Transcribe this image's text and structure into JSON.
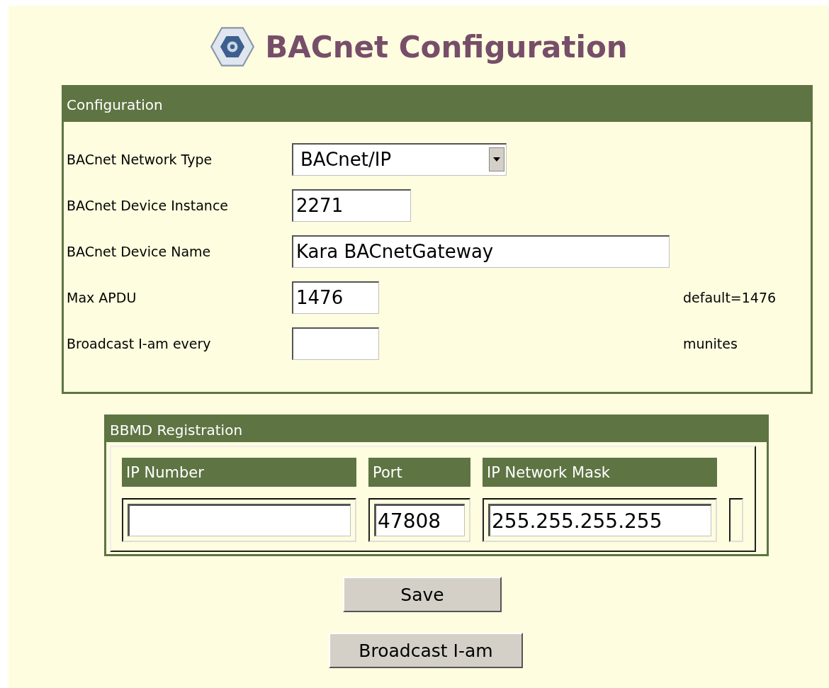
{
  "title": "BACnet Configuration",
  "configuration": {
    "heading": "Configuration",
    "fields": [
      {
        "kind": "select",
        "label": "BACnet Network Type",
        "value": "BACnet/IP"
      },
      {
        "kind": "text",
        "label": "BACnet Device Instance",
        "value": "2271"
      },
      {
        "kind": "text",
        "label": "BACnet Device Name",
        "value": "Kara BACnetGateway"
      },
      {
        "kind": "text",
        "label": "Max APDU",
        "value": "1476",
        "hint": "default=1476"
      },
      {
        "kind": "text",
        "label": "Broadcast I-am every",
        "hint": "munites"
      }
    ]
  },
  "bbmd": {
    "heading": "BBMD Registration",
    "columns": [
      "IP Number",
      "Port",
      "IP Network Mask"
    ],
    "row": [
      {
        "kind": "text"
      },
      {
        "kind": "text",
        "value": "47808"
      },
      {
        "kind": "text",
        "value": "255.255.255.255"
      }
    ]
  },
  "buttons": [
    "Save",
    "Broadcast I-am"
  ]
}
